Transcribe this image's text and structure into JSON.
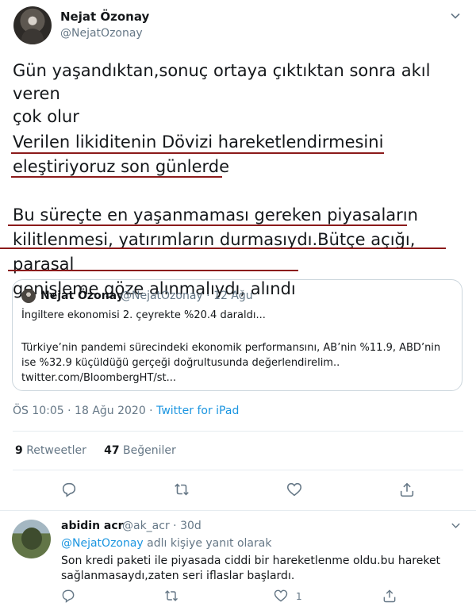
{
  "tweet": {
    "author": {
      "name": "Nejat Özonay",
      "handle": "@NejatOzonay"
    },
    "text": {
      "para1": "Gün yaşandıktan,sonuç ortaya çıktıktan sonra akıl veren\nçok olur",
      "para2_line1": "Verilen likiditenin Dövizi hareketlendirmesini",
      "para2_line2": "eleştiriyoruz son günlerde",
      "para3_line1": "Bu süreçte en yaşanmaması gereken piyasaların",
      "para3_line2": "kilitlenmesi, yatırımların durmasıydı.Bütçe açığı, parasal",
      "para3_line3": "genişleme göze alınmalıydı, alındı"
    },
    "quoted": {
      "name": "Nejat Özonay",
      "handle_date": "@NejatOzonay · 12 Ağu",
      "line1": "İngiltere ekonomisi 2. çeyrekte %20.4 daraldı...",
      "line2": "Türkiye’nin pandemi sürecindeki ekonomik performansını, AB’nin %11.9, ABD’nin ise %32.9 küçüldüğü gerçeği doğrultusunda değerlendirelim.. twitter.com/BloombergHT/st..."
    },
    "meta": {
      "time": "ÖS 10:05 · 18 Ağu 2020 · ",
      "source": "Twitter for iPad"
    },
    "stats": {
      "retweets": "9",
      "retweets_label": "Retweetler",
      "likes": "47",
      "likes_label": "Beğeniler"
    }
  },
  "reply": {
    "name": "abidin acr",
    "handle_date": "@ak_acr · 30d",
    "mention": "@NejatOzonay",
    "reply_suffix": " adlı kişiye yanıt olarak",
    "text": "Son kredi paketi ile piyasada ciddi bir hareketlenme oldu.bu hareket sağlanmasaydı,zaten seri iflaslar başlardı.",
    "like_count": "1"
  },
  "colors": {
    "accent": "#1b95e0",
    "underline": "#8b1a1a",
    "muted": "#657786"
  },
  "icons": [
    "reply-icon",
    "retweet-icon",
    "like-icon",
    "share-icon",
    "chevron-down-icon"
  ]
}
